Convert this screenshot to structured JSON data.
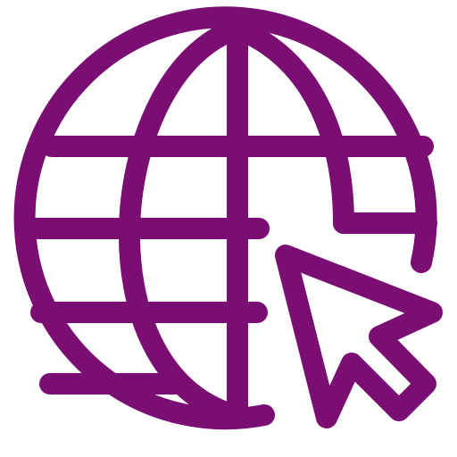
{
  "icon": {
    "name": "globe-with-cursor-icon",
    "color": "#7a0e72",
    "background": "#ffffff"
  }
}
